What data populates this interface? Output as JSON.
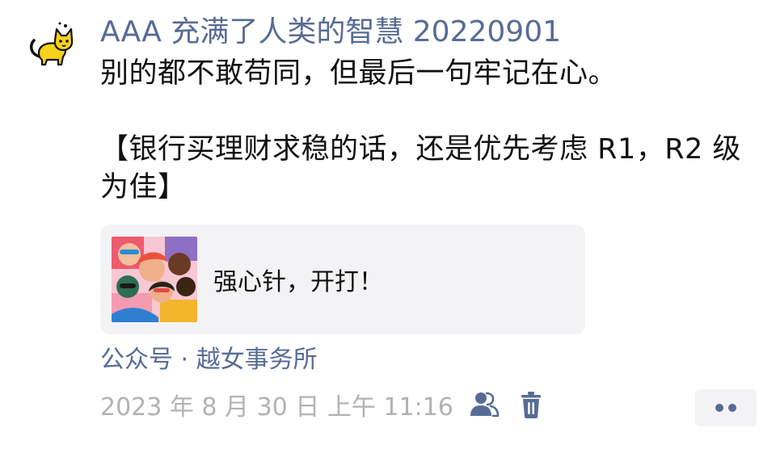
{
  "post": {
    "nickname": "AAA 充满了人类的智慧 20220901",
    "text_lines": [
      "别的都不敢苟同，但最后一句牢记在心。",
      "",
      "【银行买理财求稳的话，还是优先考虑 R1，R2 级",
      "为佳】"
    ],
    "link_card": {
      "title": "强心针，开打！"
    },
    "source": "公众号 · 越女事务所",
    "timestamp": "2023 年 8 月 30 日  上午 11:16"
  },
  "icons": {
    "avatar": "yellow-cat-avatar",
    "visibility": "people-icon",
    "delete": "trash-icon",
    "more": "more-dots-icon"
  },
  "colors": {
    "link_blue": "#576b95",
    "meta_gray": "#b2b2b2",
    "card_bg": "#f3f3f5"
  }
}
